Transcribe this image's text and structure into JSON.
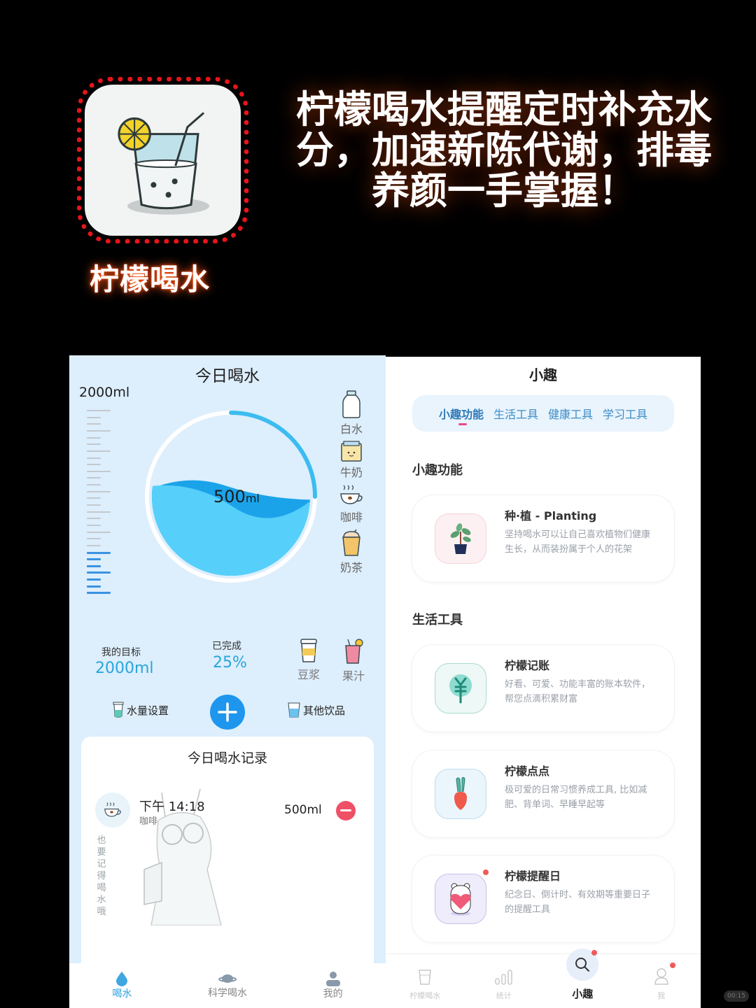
{
  "hero": {
    "app_name": "柠檬喝水",
    "headline_lines": [
      "柠檬喝水提醒定时补充水",
      "分，加速新陈代谢，排毒",
      "养颜一手掌握！"
    ]
  },
  "today_screen": {
    "title": "今日喝水",
    "scale_max_label": "2000ml",
    "current_amount": "500",
    "current_unit": "ml",
    "progress_fraction": 0.25,
    "drink_types": [
      {
        "name": "白水",
        "icon": "water-bottle-icon"
      },
      {
        "name": "牛奶",
        "icon": "milk-carton-icon"
      },
      {
        "name": "咖啡",
        "icon": "coffee-cup-icon"
      },
      {
        "name": "奶茶",
        "icon": "milk-tea-icon"
      }
    ],
    "extra_drinks": [
      {
        "name": "豆浆",
        "icon": "soy-milk-icon"
      },
      {
        "name": "果汁",
        "icon": "juice-icon"
      }
    ],
    "goal_label": "我的目标",
    "goal_value": "2000ml",
    "done_label": "已完成",
    "done_value": "25%",
    "water_setting_label": "水量设置",
    "other_drinks_label": "其他饮品",
    "record_title": "今日喝水记录",
    "records": [
      {
        "time": "下午 14:18",
        "type": "咖啡",
        "amount": "500ml"
      }
    ],
    "reminder_text": "也要记得喝水哦",
    "nav": [
      {
        "label": "喝水",
        "active": true
      },
      {
        "label": "科学喝水",
        "active": false
      },
      {
        "label": "我的",
        "active": false
      }
    ],
    "colors": {
      "accent": "#29a5dc",
      "add_button": "#1e96ee",
      "delete": "#ef5066",
      "water": "#56d0fa",
      "water_dark": "#1ba3ea"
    }
  },
  "fun_screen": {
    "title": "小趣",
    "tabs": [
      {
        "label": "小趣功能",
        "active": true
      },
      {
        "label": "生活工具",
        "active": false
      },
      {
        "label": "健康工具",
        "active": false
      },
      {
        "label": "学习工具",
        "active": false
      }
    ],
    "sections": [
      {
        "title": "小趣功能",
        "cards": [
          {
            "title": "种·植 - Planting",
            "desc": "坚持喝水可以让自己喜欢植物们健康生长，从而装扮属于个人的花架"
          }
        ]
      },
      {
        "title": "生活工具",
        "cards": [
          {
            "title": "柠檬记账",
            "desc": "好看、可爱、功能丰富的账本软件，帮您点滴积累财富"
          },
          {
            "title": "柠檬点点",
            "desc": "极可爱的日常习惯养成工具, 比如减肥、背单词、早睡早起等"
          },
          {
            "title": "柠檬提醒日",
            "desc": "纪念日、倒计时、有效期等重要日子的提醒工具"
          }
        ]
      }
    ],
    "nav": [
      {
        "label": "柠檬喝水",
        "active": false
      },
      {
        "label": "统计",
        "active": false
      },
      {
        "label": "小趣",
        "active": true
      },
      {
        "label": "我",
        "active": false
      }
    ]
  },
  "watermark": "00:15"
}
